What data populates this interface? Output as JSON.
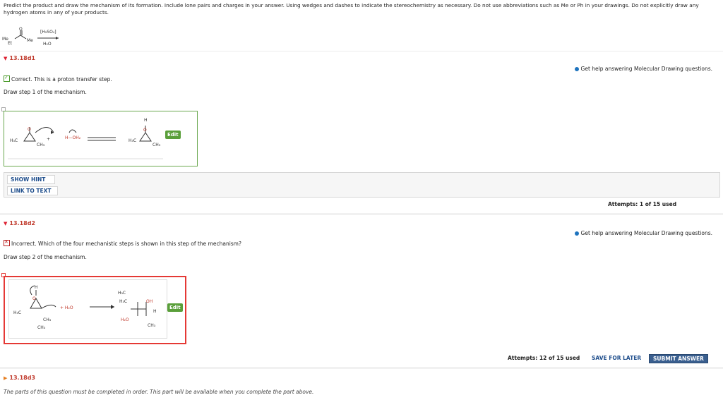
{
  "question": {
    "prompt": "Predict the product and draw the mechanism of its formation. Include lone pairs and charges in your answer. Using wedges and dashes to indicate the stereochemistry as necessary. Do not use abbreviations such as Me or Ph in your drawings. Do not explicitly draw any hydrogen atoms in any of your products.",
    "reagent_top": "[H₂SO₄]",
    "reagent_bottom": "H₂O",
    "me_left": "Me",
    "me_right": "Me",
    "et": "Et",
    "o_label": "O"
  },
  "part1": {
    "title": "13.18d1",
    "help": "Get help answering Molecular Drawing questions.",
    "status": "Correct. This is a proton transfer step.",
    "instruction": "Draw step 1 of the mechanism.",
    "edit_label": "Edit",
    "show_hint": "SHOW HINT",
    "link_text": "LINK TO TEXT",
    "attempts": "Attempts: 1 of 15 used"
  },
  "part2": {
    "title": "13.18d2",
    "help": "Get help answering Molecular Drawing questions.",
    "status": "Incorrect. Which of the four mechanistic steps is shown in this step of the mechanism?",
    "instruction": "Draw step 2 of the mechanism.",
    "edit_label": "Edit",
    "attempts": "Attempts: 12 of 15 used",
    "save_later": "SAVE FOR LATER",
    "submit": "SUBMIT ANSWER"
  },
  "part3": {
    "title": "13.18d3",
    "note": "The parts of this question must be completed in order. This part will be available when you complete the part above."
  },
  "mol_labels": {
    "h3c": "H₃C",
    "ch3": "CH₃",
    "h2o_plus": "+ H₂O",
    "oh": "OH",
    "h2o_red": "H₂O",
    "h": "H",
    "plus": "+",
    "h_oh2": "H—OH₂"
  },
  "colors": {
    "correct_border": "#6aa84f",
    "incorrect_border": "#e53935",
    "accent": "#1f4e8c"
  }
}
